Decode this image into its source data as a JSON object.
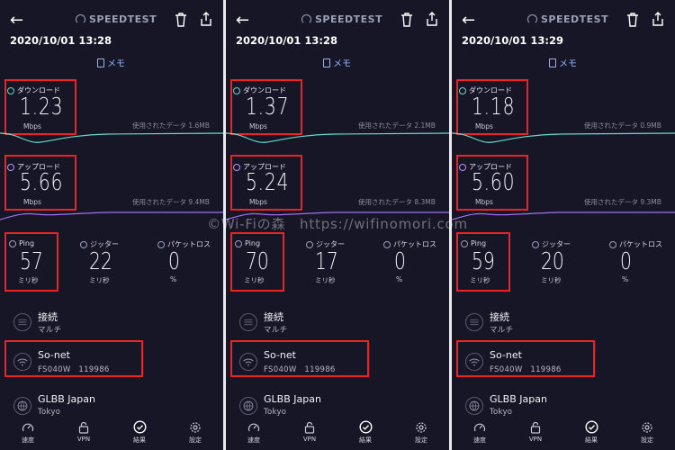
{
  "app": {
    "brand": "SPEEDTEST",
    "memo_label": "メモ"
  },
  "labels": {
    "download": "ダウンロード",
    "upload": "アップロード",
    "unit_mbps": "Mbps",
    "ping": "Ping",
    "jitter": "ジッター",
    "packet_loss": "パケットロス",
    "unit_ms": "ミリ秒",
    "unit_percent": "%",
    "connection": "接続",
    "connection_type": "マルチ"
  },
  "nav": [
    {
      "label": "速度",
      "icon": "speedometer-icon"
    },
    {
      "label": "VPN",
      "icon": "lock-icon"
    },
    {
      "label": "結果",
      "icon": "check-circle-icon"
    },
    {
      "label": "設定",
      "icon": "gear-icon"
    }
  ],
  "screens": [
    {
      "datetime": "2020/10/01 13:28",
      "download": "1.23",
      "download_used": "使用されたデータ 1.6MB",
      "upload": "5.66",
      "upload_used": "使用されたデータ 9.4MB",
      "ping": "57",
      "jitter": "22",
      "packet_loss": "0",
      "isp": "So-net",
      "device": "FS040W　119986",
      "server": "GLBB Japan",
      "server_city": "Tokyo"
    },
    {
      "datetime": "2020/10/01 13:28",
      "download": "1.37",
      "download_used": "使用されたデータ 2.1MB",
      "upload": "5.24",
      "upload_used": "使用されたデータ 8.3MB",
      "ping": "70",
      "jitter": "17",
      "packet_loss": "0",
      "isp": "So-net",
      "device": "FS040W　119986",
      "server": "GLBB Japan",
      "server_city": "Tokyo"
    },
    {
      "datetime": "2020/10/01 13:29",
      "download": "1.18",
      "download_used": "使用されたデータ 0.9MB",
      "upload": "5.60",
      "upload_used": "使用されたデータ 9.3MB",
      "ping": "59",
      "jitter": "20",
      "packet_loss": "0",
      "isp": "So-net",
      "device": "FS040W　119986",
      "server": "GLBB Japan",
      "server_city": "Tokyo"
    }
  ],
  "colors": {
    "download": "#66d9cf",
    "upload": "#a070f0",
    "highlight": "#e22222",
    "background": "#161627"
  },
  "watermark": "©Wi-Fiの森　https://wifinomori.com"
}
